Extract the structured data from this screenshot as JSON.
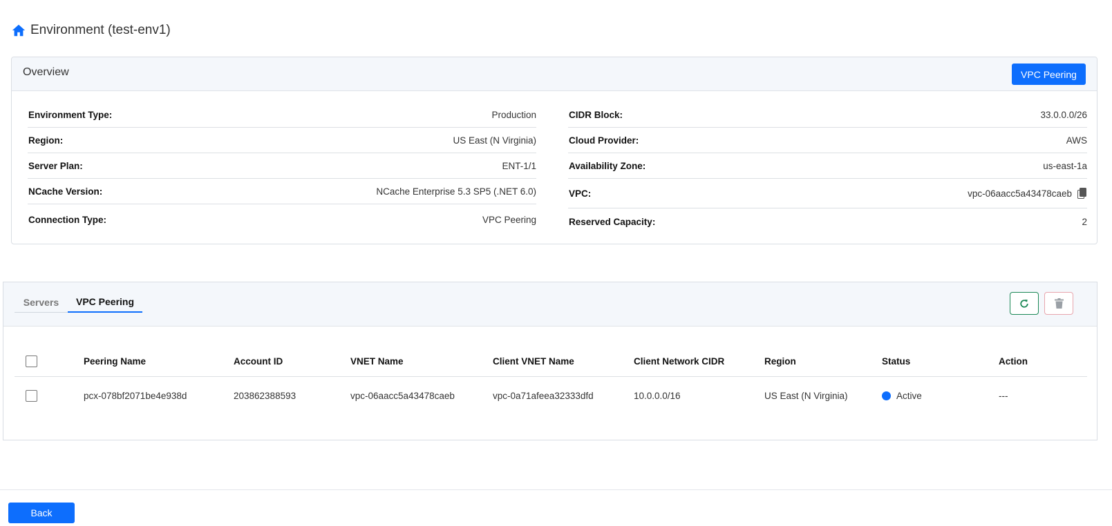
{
  "page": {
    "title": "Environment (test-env1)",
    "home_icon": "home-icon"
  },
  "colors": {
    "primary": "#0d6efd",
    "success": "#198754",
    "danger_light": "#e8a5ad",
    "header_bg": "#f4f7fb",
    "status_active": "#0d6efd"
  },
  "overview": {
    "title": "Overview",
    "vpc_peering_button": "VPC Peering",
    "left_details": [
      {
        "label": "Environment Type:",
        "value": "Production"
      },
      {
        "label": "Region:",
        "value": "US East (N Virginia)"
      },
      {
        "label": "Server Plan:",
        "value": "ENT-1/1"
      },
      {
        "label": "NCache Version:",
        "value": "NCache Enterprise 5.3 SP5 (.NET 6.0)"
      },
      {
        "label": "Connection Type:",
        "value": "VPC Peering"
      }
    ],
    "right_details": [
      {
        "label": "CIDR Block:",
        "value": "33.0.0.0/26"
      },
      {
        "label": "Cloud Provider:",
        "value": "AWS"
      },
      {
        "label": "Availability Zone:",
        "value": "us-east-1a"
      },
      {
        "label": "VPC:",
        "value": "vpc-06aacc5a43478caeb",
        "icon": "copy-icon"
      },
      {
        "label": "Reserved Capacity:",
        "value": "2"
      }
    ]
  },
  "tabs": {
    "items": [
      {
        "label": "Servers",
        "active": false
      },
      {
        "label": "VPC Peering",
        "active": true
      }
    ],
    "refresh_icon": "refresh-icon",
    "delete_icon": "trash-icon"
  },
  "table": {
    "columns": [
      "Peering Name",
      "Account ID",
      "VNET Name",
      "Client VNET Name",
      "Client Network CIDR",
      "Region",
      "Status",
      "Action"
    ],
    "rows": [
      {
        "peering_name": "pcx-078bf2071be4e938d",
        "account_id": "203862388593",
        "vnet_name": "vpc-06aacc5a43478caeb",
        "client_vnet_name": "vpc-0a71afeea32333dfd",
        "client_network_cidr": "10.0.0.0/16",
        "region": "US East (N Virginia)",
        "status": "Active",
        "action": "---"
      }
    ]
  },
  "footer": {
    "back_button": "Back"
  }
}
